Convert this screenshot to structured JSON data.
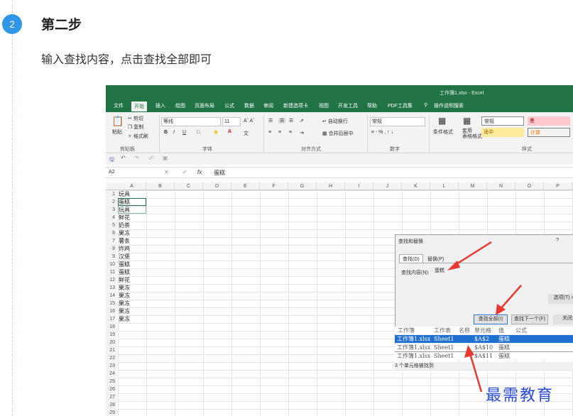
{
  "step": {
    "number": "2",
    "title": "第二步",
    "desc": "输入查找内容，点击查找全部即可"
  },
  "excel": {
    "window_title": "工作簿1.xlsx - Excel",
    "tabs": [
      "文件",
      "开始",
      "插入",
      "绘图",
      "页面布局",
      "公式",
      "数据",
      "审阅",
      "新建选项卡",
      "视图",
      "开发工具",
      "帮助",
      "PDF工具集",
      "操作说明搜索"
    ],
    "clipboard": {
      "paste": "粘贴",
      "cut": "剪切",
      "copy": "复制",
      "format_painter": "格式刷",
      "group": "剪贴板"
    },
    "font": {
      "name": "等线",
      "size": "11",
      "group": "字体"
    },
    "alignment": {
      "wrap": "自动换行",
      "merge": "合并后居中",
      "group": "对齐方式"
    },
    "number": {
      "format": "常规",
      "group": "数字"
    },
    "styles": {
      "cond": "条件格式",
      "table": "套用\n表格格式",
      "normal": "常规",
      "bad": "差",
      "neutral": "适中",
      "calc": "计算",
      "group": "样式"
    },
    "namebox": "A2",
    "formula_value": "蛋糕",
    "columns": [
      "A",
      "B",
      "C",
      "D",
      "E",
      "F",
      "G",
      "H",
      "I",
      "J",
      "K",
      "L",
      "M",
      "N",
      "O",
      "P"
    ],
    "rows": [
      "1",
      "2",
      "3",
      "4",
      "5",
      "6",
      "7",
      "8",
      "9",
      "10",
      "11",
      "12",
      "13",
      "14",
      "15",
      "16",
      "17",
      "18",
      "19",
      "20",
      "21",
      "22",
      "23",
      "24",
      "25",
      "26",
      "27",
      "28",
      "29"
    ],
    "cells": [
      "玩具",
      "蛋糕",
      "玩具",
      "鲜花",
      "奶茶",
      "果冻",
      "薯条",
      "炸鸡",
      "汉堡",
      "蛋糕",
      "蛋糕",
      "鲜花",
      "果冻",
      "果冻",
      "果冻",
      "果冻",
      "果冻"
    ]
  },
  "dialog": {
    "title": "查找和替换",
    "help": "?",
    "tab_find": "查找(D)",
    "tab_replace": "替换(P)",
    "find_label": "查找内容(N):",
    "find_value": "蛋糕",
    "options": "选项(T) »",
    "find_all": "查找全部(I)",
    "find_next": "查找下一个(F)",
    "close": "关闭",
    "headers": [
      "工作簿",
      "工作表",
      "名称",
      "单元格",
      "值",
      "公式"
    ],
    "results": [
      [
        "工作簿1.xlsx",
        "Sheet1",
        "",
        "$A$2",
        "蛋糕"
      ],
      [
        "工作簿1.xlsx",
        "Sheet1",
        "",
        "$A$10",
        "蛋糕"
      ],
      [
        "工作簿1.xlsx",
        "Sheet1",
        "",
        "$A$11",
        "蛋糕"
      ]
    ],
    "status": "3 个单元格被找到"
  },
  "watermark": "最需教育",
  "colors": {
    "excel_green": "#217346",
    "step_blue": "#2f96e8",
    "arrow_red": "#e8382f",
    "selected": "#1e6fd0"
  }
}
